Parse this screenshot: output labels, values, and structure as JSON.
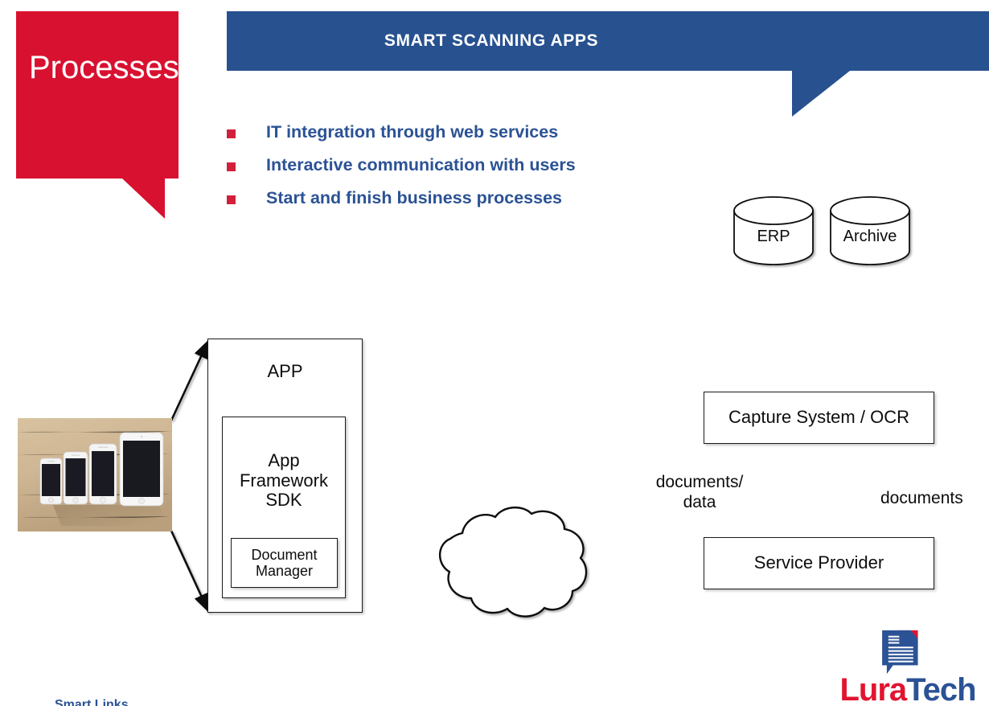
{
  "slide": {
    "title_callout": "Processes",
    "banner_title": "SMART SCANNING APPS",
    "bottom_caption": "Smart Links"
  },
  "colors": {
    "red": "#D2203C",
    "blue": "#2B5295",
    "logo_red": "#E2142F",
    "diagram_stroke": "#1a1a1a",
    "background": "#ffffff"
  },
  "bullets": [
    {
      "text": "IT integration through web services"
    },
    {
      "text": "Interactive communication with users"
    },
    {
      "text": "Start and finish business processes"
    }
  ],
  "diagram": {
    "devices_photo_alt": "four apple mobile devices on a wooden desk",
    "app_box": "APP",
    "sdk_box": "App\nFramework\nSDK",
    "sdk_box_lines": [
      "App",
      "Framework",
      "SDK"
    ],
    "document_manager_lines": [
      "Document",
      "Manager"
    ],
    "cloud": "",
    "service_provider": "Service Provider",
    "capture_system": "Capture System / OCR",
    "databases": [
      {
        "label": "ERP"
      },
      {
        "label": "Archive"
      }
    ],
    "edge_labels": [
      {
        "id": "documents-data",
        "lines": [
          "documents/",
          "data"
        ]
      },
      {
        "id": "documents",
        "lines": [
          "documents"
        ]
      }
    ]
  },
  "logo": {
    "word_first": "Lura",
    "word_second": "Tech"
  }
}
